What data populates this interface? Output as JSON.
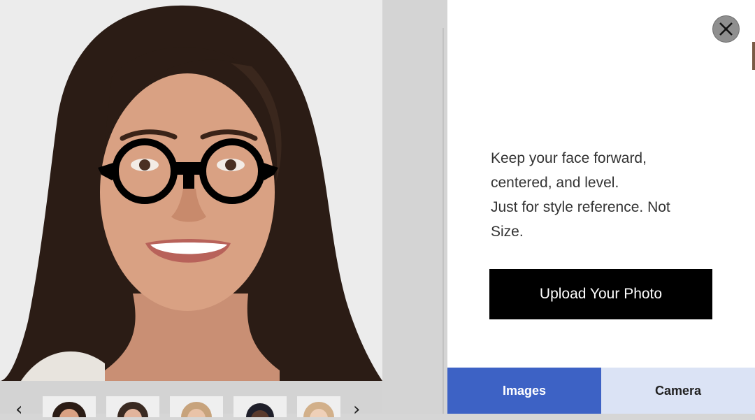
{
  "panel": {
    "instructions": [
      "Keep your face forward,",
      "centered, and level.",
      "Just for style reference. Not",
      "Size."
    ],
    "upload_label": "Upload Your Photo",
    "tabs": [
      {
        "label": "Images",
        "active": true
      },
      {
        "label": "Camera",
        "active": false
      }
    ]
  },
  "thumbnails": {
    "prev_icon": "chevron-left-icon",
    "next_icon": "chevron-right-icon",
    "count_visible": 5
  },
  "colors": {
    "active_tab": "#3d62c5",
    "inactive_tab": "#dbe3f5",
    "upload_button": "#000000",
    "close_button": "#8f8f8f"
  },
  "icons": {
    "close": "close-icon"
  }
}
